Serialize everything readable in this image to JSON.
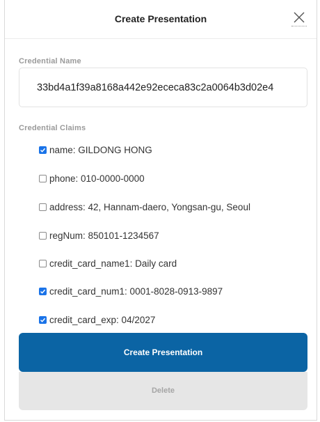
{
  "dialog": {
    "title": "Create Presentation",
    "close_icon": "close-icon"
  },
  "credential_name": {
    "label": "Credential Name",
    "value": "33bd4a1f39a8168a442e92ececa83c2a0064b3d02e4"
  },
  "claims": {
    "label": "Credential Claims",
    "items": [
      {
        "text": "name: GILDONG HONG",
        "checked": true
      },
      {
        "text": "phone: 010-0000-0000",
        "checked": false
      },
      {
        "text": "address: 42, Hannam-daero, Yongsan-gu, Seoul",
        "checked": false
      },
      {
        "text": "regNum: 850101-1234567",
        "checked": false
      },
      {
        "text": "credit_card_name1: Daily card",
        "checked": false
      },
      {
        "text": "credit_card_num1: 0001-8028-0913-9897",
        "checked": true
      },
      {
        "text": "credit_card_exp: 04/2027",
        "checked": true
      }
    ]
  },
  "actions": {
    "create_label": "Create Presentation",
    "delete_label": "Delete"
  },
  "colors": {
    "primary": "#0b64a4",
    "checkbox": "#1a73e8",
    "disabled_bg": "#e6e6e6"
  }
}
